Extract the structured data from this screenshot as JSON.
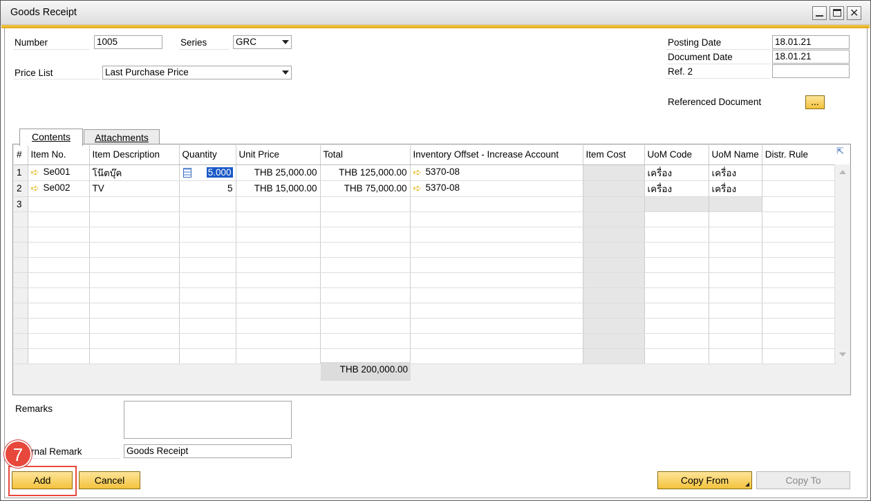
{
  "window": {
    "title": "Goods Receipt"
  },
  "header": {
    "number_label": "Number",
    "number_value": "1005",
    "series_label": "Series",
    "series_value": "GRC",
    "price_list_label": "Price List",
    "price_list_value": "Last Purchase Price",
    "posting_date_label": "Posting Date",
    "posting_date_value": "18.01.21",
    "document_date_label": "Document Date",
    "document_date_value": "18.01.21",
    "ref2_label": "Ref. 2",
    "ref2_value": "",
    "referenced_document_label": "Referenced Document",
    "referenced_document_button": "..."
  },
  "tabs": [
    {
      "label": "Contents"
    },
    {
      "label": "Attachments"
    }
  ],
  "grid": {
    "columns": [
      "#",
      "Item No.",
      "Item Description",
      "Quantity",
      "Unit Price",
      "Total",
      "Inventory Offset - Increase Account",
      "Item Cost",
      "UoM Code",
      "UoM Name",
      "Distr. Rule"
    ],
    "rows": [
      {
        "num": "1",
        "item_no": "Se001",
        "description": "โน๊ตบุ๊ค",
        "quantity": "5.000",
        "unit_price": "THB 25,000.00",
        "total": "THB 125,000.00",
        "account": "5370-08",
        "item_cost": "",
        "uom_code": "เครื่อง",
        "uom_name": "เครื่อง",
        "distr_rule": ""
      },
      {
        "num": "2",
        "item_no": "Se002",
        "description": "TV",
        "quantity": "5",
        "unit_price": "THB 15,000.00",
        "total": "THB 75,000.00",
        "account": "5370-08",
        "item_cost": "",
        "uom_code": "เครื่อง",
        "uom_name": "เครื่อง",
        "distr_rule": ""
      },
      {
        "num": "3",
        "item_no": "",
        "description": "",
        "quantity": "",
        "unit_price": "",
        "total": "",
        "account": "",
        "item_cost": "",
        "uom_code": "",
        "uom_name": "",
        "distr_rule": ""
      }
    ],
    "grand_total": "THB 200,000.00"
  },
  "footer": {
    "remarks_label": "Remarks",
    "remarks_value": "",
    "journal_remark_label": "rnal Remark",
    "journal_remark_value": "Goods Receipt",
    "add_button": "Add",
    "cancel_button": "Cancel",
    "copy_from_button": "Copy From",
    "copy_to_button": "Copy To"
  },
  "annotation": {
    "step": "7",
    "color": "#e8473b"
  }
}
